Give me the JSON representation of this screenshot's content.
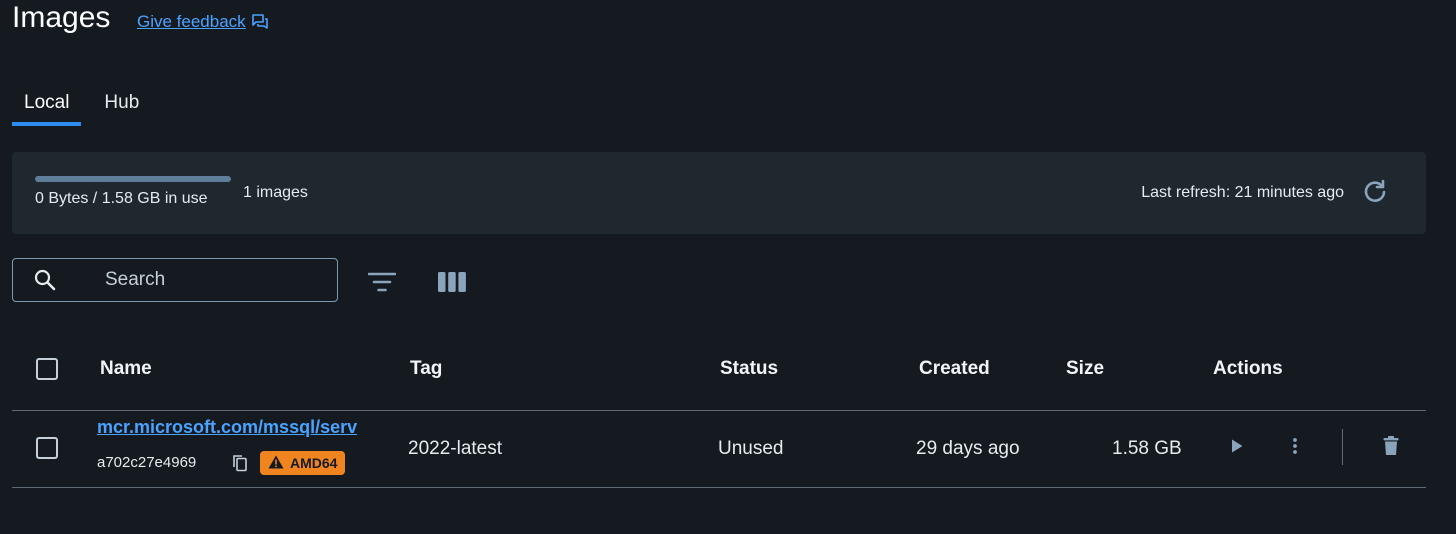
{
  "header": {
    "title": "Images",
    "feedback_label": "Give feedback"
  },
  "tabs": [
    {
      "label": "Local",
      "active": true
    },
    {
      "label": "Hub",
      "active": false
    }
  ],
  "summary": {
    "usage_text": "0 Bytes / 1.58 GB in use",
    "usage_fraction": 0,
    "image_count": "1 images",
    "last_refresh": "Last refresh: 21 minutes ago"
  },
  "toolbar": {
    "search_placeholder": "Search",
    "search_value": ""
  },
  "table": {
    "columns": [
      "Name",
      "Tag",
      "Status",
      "Created",
      "Size",
      "Actions"
    ],
    "rows": [
      {
        "name": "mcr.microsoft.com/mssql/serv",
        "image_id": "a702c27e4969",
        "arch_badge": "AMD64",
        "tag": "2022-latest",
        "status": "Unused",
        "created": "29 days ago",
        "size": "1.58 GB"
      }
    ]
  },
  "colors": {
    "background": "#141a20",
    "panel": "#1f272f",
    "accent": "#2d8cf0",
    "link": "#4aa3ff",
    "warning_badge": "#f0851f"
  },
  "icons": {
    "feedback": "feedback-icon",
    "refresh": "refresh-icon",
    "search": "search-icon",
    "filter": "filter-icon",
    "columns": "columns-icon",
    "copy": "copy-icon",
    "warning": "warning-icon",
    "run": "play-icon",
    "more": "more-vertical-icon",
    "delete": "trash-icon"
  }
}
